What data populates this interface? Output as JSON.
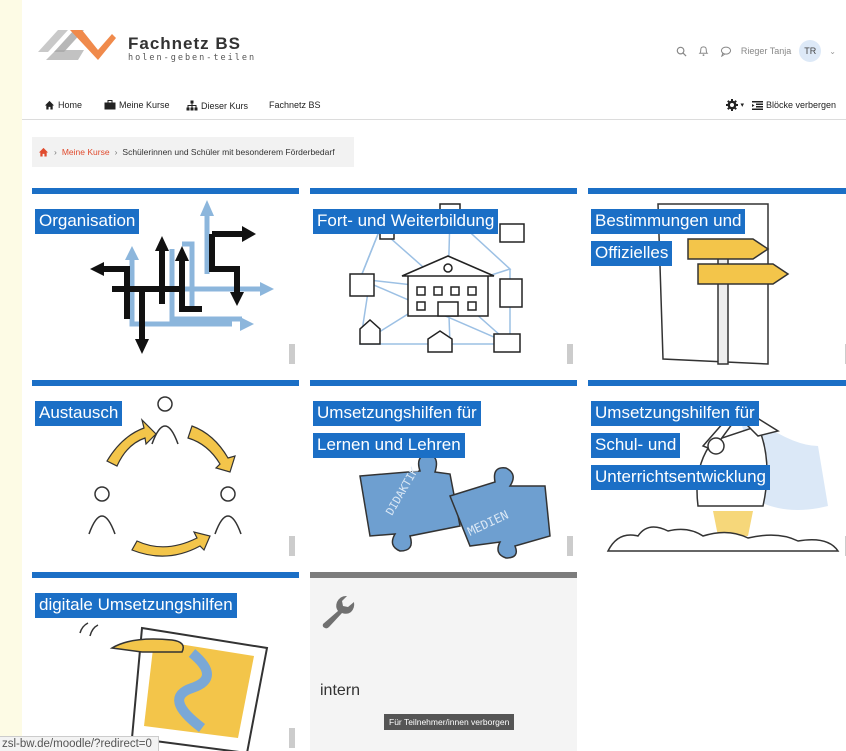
{
  "header": {
    "brand_name": "Fachnetz BS",
    "brand_tagline": "holen-geben-teilen",
    "user_name": "Rieger Tanja",
    "user_initials": "TR"
  },
  "nav": {
    "items": [
      {
        "label": "Home",
        "icon": "home-icon"
      },
      {
        "label": "Meine Kurse",
        "icon": "briefcase-icon"
      },
      {
        "label": "Dieser Kurs",
        "icon": "sitemap-icon"
      },
      {
        "label": "Fachnetz BS",
        "icon": ""
      }
    ],
    "settings_icon": "gear-icon",
    "hide_blocks_label": "Blöcke verbergen"
  },
  "breadcrumb": {
    "home_icon": "home-icon",
    "link": "Meine Kurse",
    "current": "Schülerinnen und Schüler mit besonderem Förderbedarf"
  },
  "tiles": [
    {
      "lines": [
        "Organisation"
      ]
    },
    {
      "lines": [
        "Fort- und Weiterbildung"
      ]
    },
    {
      "lines": [
        "Bestimmungen und",
        "Offizielles"
      ]
    },
    {
      "lines": [
        "Austausch"
      ]
    },
    {
      "lines": [
        "Umsetzungshilfen für",
        "Lernen und Lehren"
      ],
      "puzzle_words": [
        "DIDAKTIK",
        "MEDIEN"
      ]
    },
    {
      "lines": [
        "Umsetzungshilfen für",
        "Schul- und",
        "Unterrichtsentwicklung"
      ]
    },
    {
      "lines": [
        "digitale Umsetzungshilfen"
      ]
    },
    {
      "intern_label": "intern",
      "hidden_badge": "Für Teilnehmer/innen verborgen"
    }
  ],
  "status_url": "zsl-bw.de/moodle/?redirect=0",
  "colors": {
    "accent_blue": "#1b6fc6",
    "link_red": "#e04b2e",
    "page_bg": "#fdfbe5"
  }
}
